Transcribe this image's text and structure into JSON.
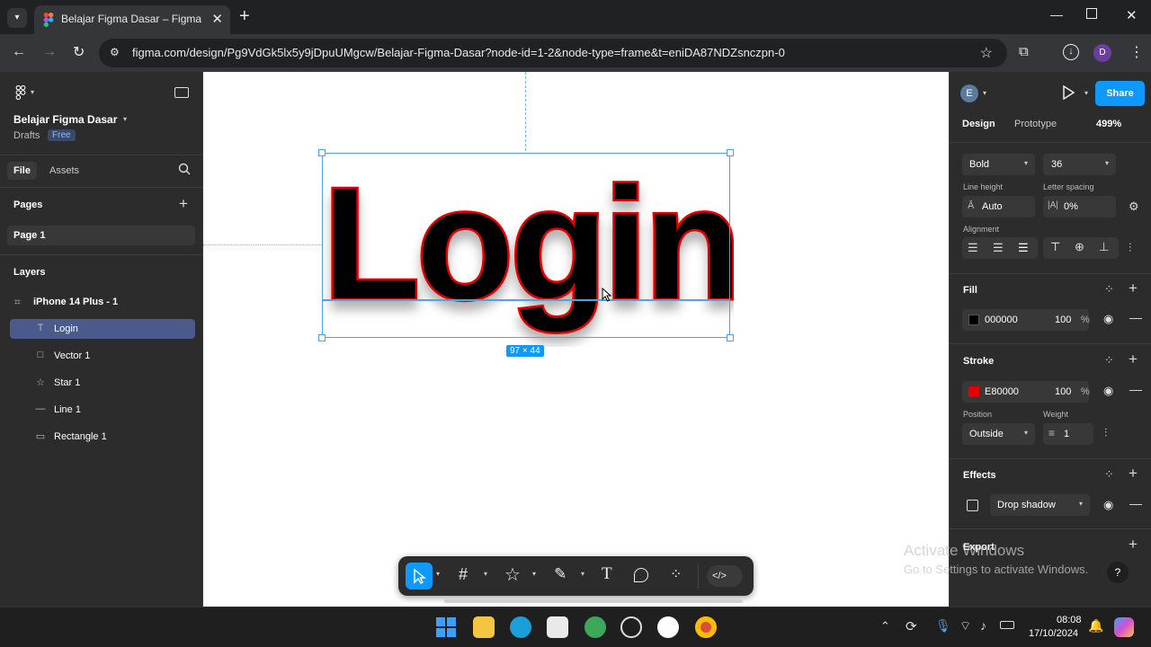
{
  "browser": {
    "tab_title": "Belajar Figma Dasar – Figma",
    "new_tab": "+",
    "url": "figma.com/design/Pg9VdGk5lx5y9jDpuUMgcw/Belajar-Figma-Dasar?node-id=1-2&node-type=frame&t=eniDA87NDZsnczpn-0",
    "profile_initial": "D"
  },
  "left_panel": {
    "file_name": "Belajar Figma Dasar",
    "location": "Drafts",
    "plan_badge": "Free",
    "tabs": [
      "File",
      "Assets"
    ],
    "pages_title": "Pages",
    "pages": [
      "Page 1"
    ],
    "layers_title": "Layers",
    "frame_name": "iPhone 14 Plus - 1",
    "layers": [
      {
        "icon": "T",
        "name": "Login",
        "selected": true
      },
      {
        "icon": "□",
        "name": "Vector 1"
      },
      {
        "icon": "☆",
        "name": "Star 1"
      },
      {
        "icon": "—",
        "name": "Line 1"
      },
      {
        "icon": "▭",
        "name": "Rectangle 1"
      }
    ]
  },
  "canvas": {
    "text": "Login",
    "size_badge": "97 × 44",
    "text_color": "#000000",
    "stroke_color": "#E80000"
  },
  "right_panel": {
    "user_initial": "E",
    "share": "Share",
    "tabs": [
      "Design",
      "Prototype"
    ],
    "zoom": "499%",
    "font_weight": "Bold",
    "font_size": "36",
    "line_height_label": "Line height",
    "line_height": "Auto",
    "letter_spacing_label": "Letter spacing",
    "letter_spacing": "0%",
    "alignment_label": "Alignment",
    "fill_title": "Fill",
    "fill": {
      "hex": "000000",
      "opacity": "100",
      "unit": "%"
    },
    "stroke_title": "Stroke",
    "stroke": {
      "hex": "E80000",
      "opacity": "100",
      "unit": "%"
    },
    "position_label": "Position",
    "position": "Outside",
    "weight_label": "Weight",
    "weight": "1",
    "effects_title": "Effects",
    "effect": "Drop shadow",
    "export_title": "Export"
  },
  "watermark": {
    "line1": "Activate Windows",
    "line2": "Go to Settings to activate Windows."
  },
  "taskbar": {
    "time": "08:08",
    "date": "17/10/2024"
  },
  "colors": {
    "accent": "#0d99ff",
    "selection": "#4a5a8a",
    "stroke_red": "#e80000"
  }
}
